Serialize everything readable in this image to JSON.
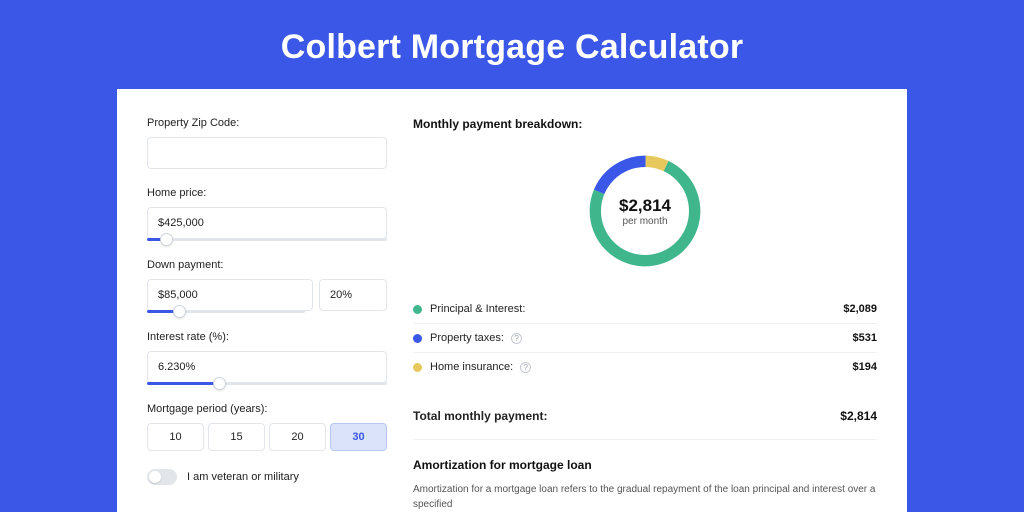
{
  "title": "Colbert Mortgage Calculator",
  "form": {
    "zip_label": "Property Zip Code:",
    "zip_value": "",
    "price_label": "Home price:",
    "price_value": "$425,000",
    "price_slider_pct": 8,
    "dp_label": "Down payment:",
    "dp_value": "$85,000",
    "dp_pct": "20%",
    "dp_slider_pct": 20,
    "rate_label": "Interest rate (%):",
    "rate_value": "6.230%",
    "rate_slider_pct": 30,
    "period_label": "Mortgage period (years):",
    "periods": [
      "10",
      "15",
      "20",
      "30"
    ],
    "period_selected": "30",
    "veteran_label": "I am veteran or military"
  },
  "breakdown": {
    "title": "Monthly payment breakdown:",
    "center_amount": "$2,814",
    "center_sub": "per month",
    "items": [
      {
        "label": "Principal & Interest:",
        "value": "$2,089",
        "color": "green",
        "info": false
      },
      {
        "label": "Property taxes:",
        "value": "$531",
        "color": "blue",
        "info": true
      },
      {
        "label": "Home insurance:",
        "value": "$194",
        "color": "yellow",
        "info": true
      }
    ],
    "total_label": "Total monthly payment:",
    "total_value": "$2,814"
  },
  "amort": {
    "title": "Amortization for mortgage loan",
    "body": "Amortization for a mortgage loan refers to the gradual repayment of the loan principal and interest over a specified"
  },
  "chart_data": {
    "type": "pie",
    "title": "Monthly payment breakdown",
    "series": [
      {
        "name": "Principal & Interest",
        "value": 2089,
        "color": "#3fb68b"
      },
      {
        "name": "Property taxes",
        "value": 531,
        "color": "#3a57e8"
      },
      {
        "name": "Home insurance",
        "value": 194,
        "color": "#e7c85d"
      }
    ],
    "total": 2814,
    "center_label": "$2,814 per month"
  }
}
